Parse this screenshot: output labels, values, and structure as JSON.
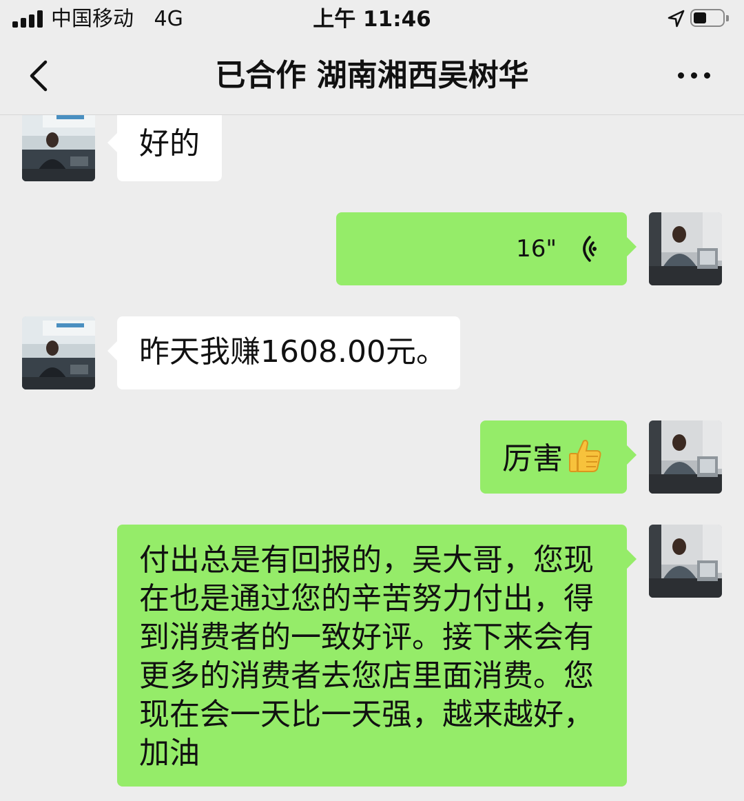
{
  "status_bar": {
    "carrier": "中国移动",
    "network": "4G",
    "time": "上午 11:46",
    "icons": [
      "signal-icon",
      "location-arrow-icon",
      "battery-icon"
    ]
  },
  "nav": {
    "back_icon": "chevron-left-icon",
    "title": "已合作 湖南湘西吴树华",
    "more_icon": "more-dots-icon"
  },
  "colors": {
    "background": "#ededed",
    "incoming_bubble": "#ffffff",
    "outgoing_bubble": "#95ec69"
  },
  "messages": [
    {
      "direction": "incoming",
      "type": "text",
      "text": "好的"
    },
    {
      "direction": "outgoing",
      "type": "voice",
      "duration": "16\"",
      "icon": "voice-wave-icon"
    },
    {
      "direction": "incoming",
      "type": "text",
      "text": "昨天我赚1608.00元。"
    },
    {
      "direction": "outgoing",
      "type": "text",
      "text": "厉害",
      "emoji": "thumbs-up-icon"
    },
    {
      "direction": "outgoing",
      "type": "text",
      "lines": [
        "付出总是有回报的，吴大哥，您现",
        "在也是通过您的辛苦努力付出，得",
        "到消费者的一致好评。接下来会有",
        "更多的消费者去您店里面消费。您",
        "现在会一天比一天强，越来越好，",
        "加油"
      ]
    }
  ]
}
